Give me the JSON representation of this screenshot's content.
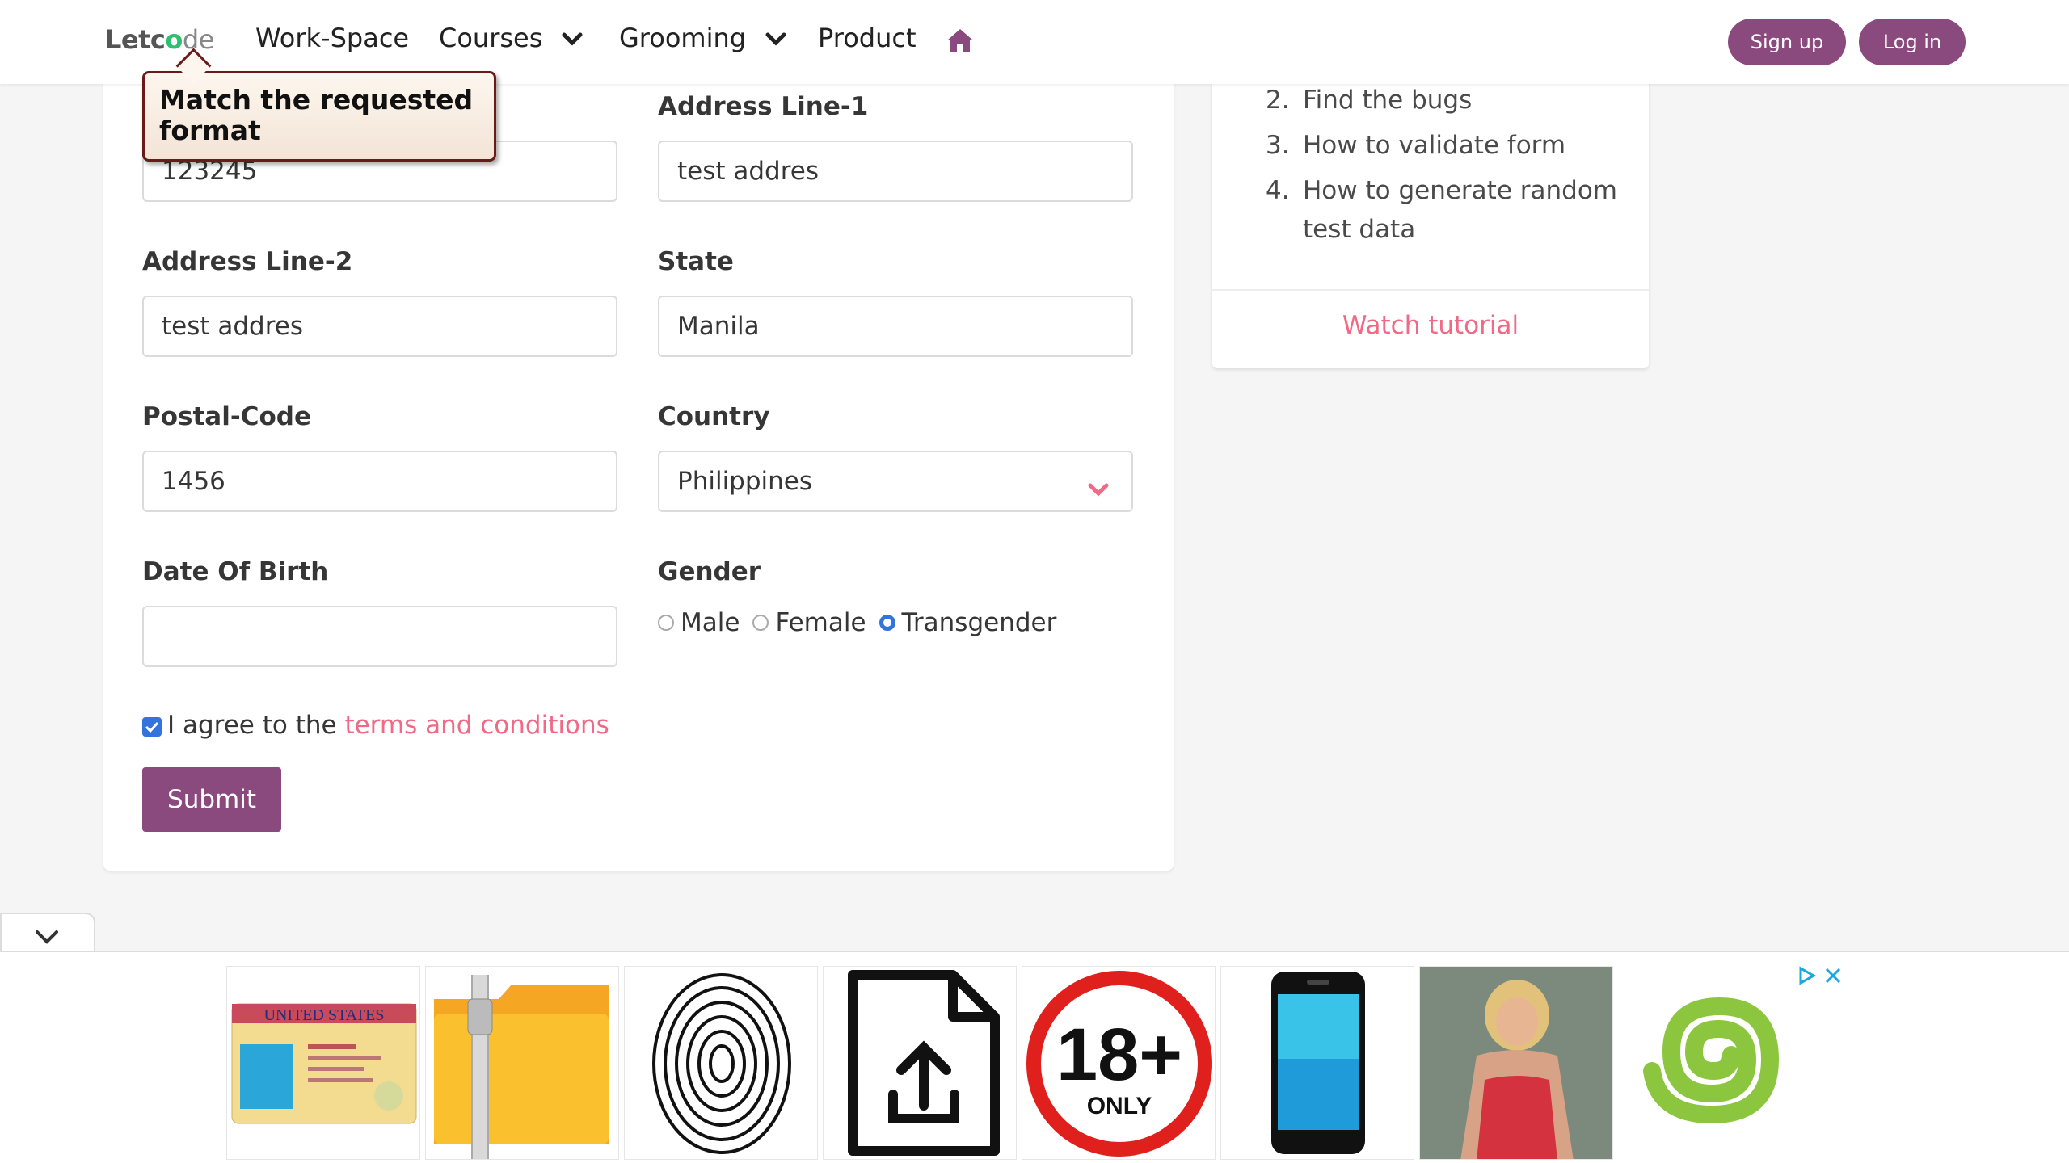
{
  "navbar": {
    "logo_left": "Letc",
    "logo_o": "o",
    "logo_right": "de",
    "items": [
      {
        "label": "Work-Space"
      },
      {
        "label": "Courses"
      },
      {
        "label": "Grooming"
      },
      {
        "label": "Product"
      }
    ],
    "signup_label": "Sign up",
    "login_label": "Log in"
  },
  "tooltip": {
    "text": "Match the requested format"
  },
  "form": {
    "first_field_value": "123245",
    "address1": {
      "label": "Address Line-1",
      "value": "test addres"
    },
    "address2": {
      "label": "Address Line-2",
      "value": "test addres"
    },
    "state": {
      "label": "State",
      "value": "Manila"
    },
    "postal": {
      "label": "Postal-Code",
      "value": "1456"
    },
    "country": {
      "label": "Country",
      "value": "Philippines"
    },
    "dob": {
      "label": "Date Of Birth",
      "value": ""
    },
    "gender": {
      "label": "Gender",
      "options": [
        "Male",
        "Female",
        "Transgender"
      ],
      "selected": "Transgender"
    },
    "agree_text": "I agree to the",
    "agree_link": "terms and conditions",
    "agree_checked": true,
    "submit_label": "Submit"
  },
  "side": {
    "items": [
      {
        "num": "2.",
        "text": "Find the bugs"
      },
      {
        "num": "3.",
        "text": "How to validate form"
      },
      {
        "num": "4.",
        "text": "How to generate random"
      },
      {
        "num": "",
        "text": "test data"
      }
    ],
    "watch_label": "Watch tutorial"
  },
  "ad": {
    "tiles": [
      "driver-license-image",
      "zip-folder-image",
      "fingerprint-image",
      "file-upload-image",
      "18-plus-image",
      "smartphone-image",
      "woman-photo",
      "spiral-logo"
    ],
    "license_text": "UNITED STATES",
    "eighteen_text": "18+",
    "only_text": "ONLY"
  },
  "colors": {
    "brand": "#8b4a7d",
    "link": "#f06a86",
    "checkbox": "#3273dc"
  }
}
